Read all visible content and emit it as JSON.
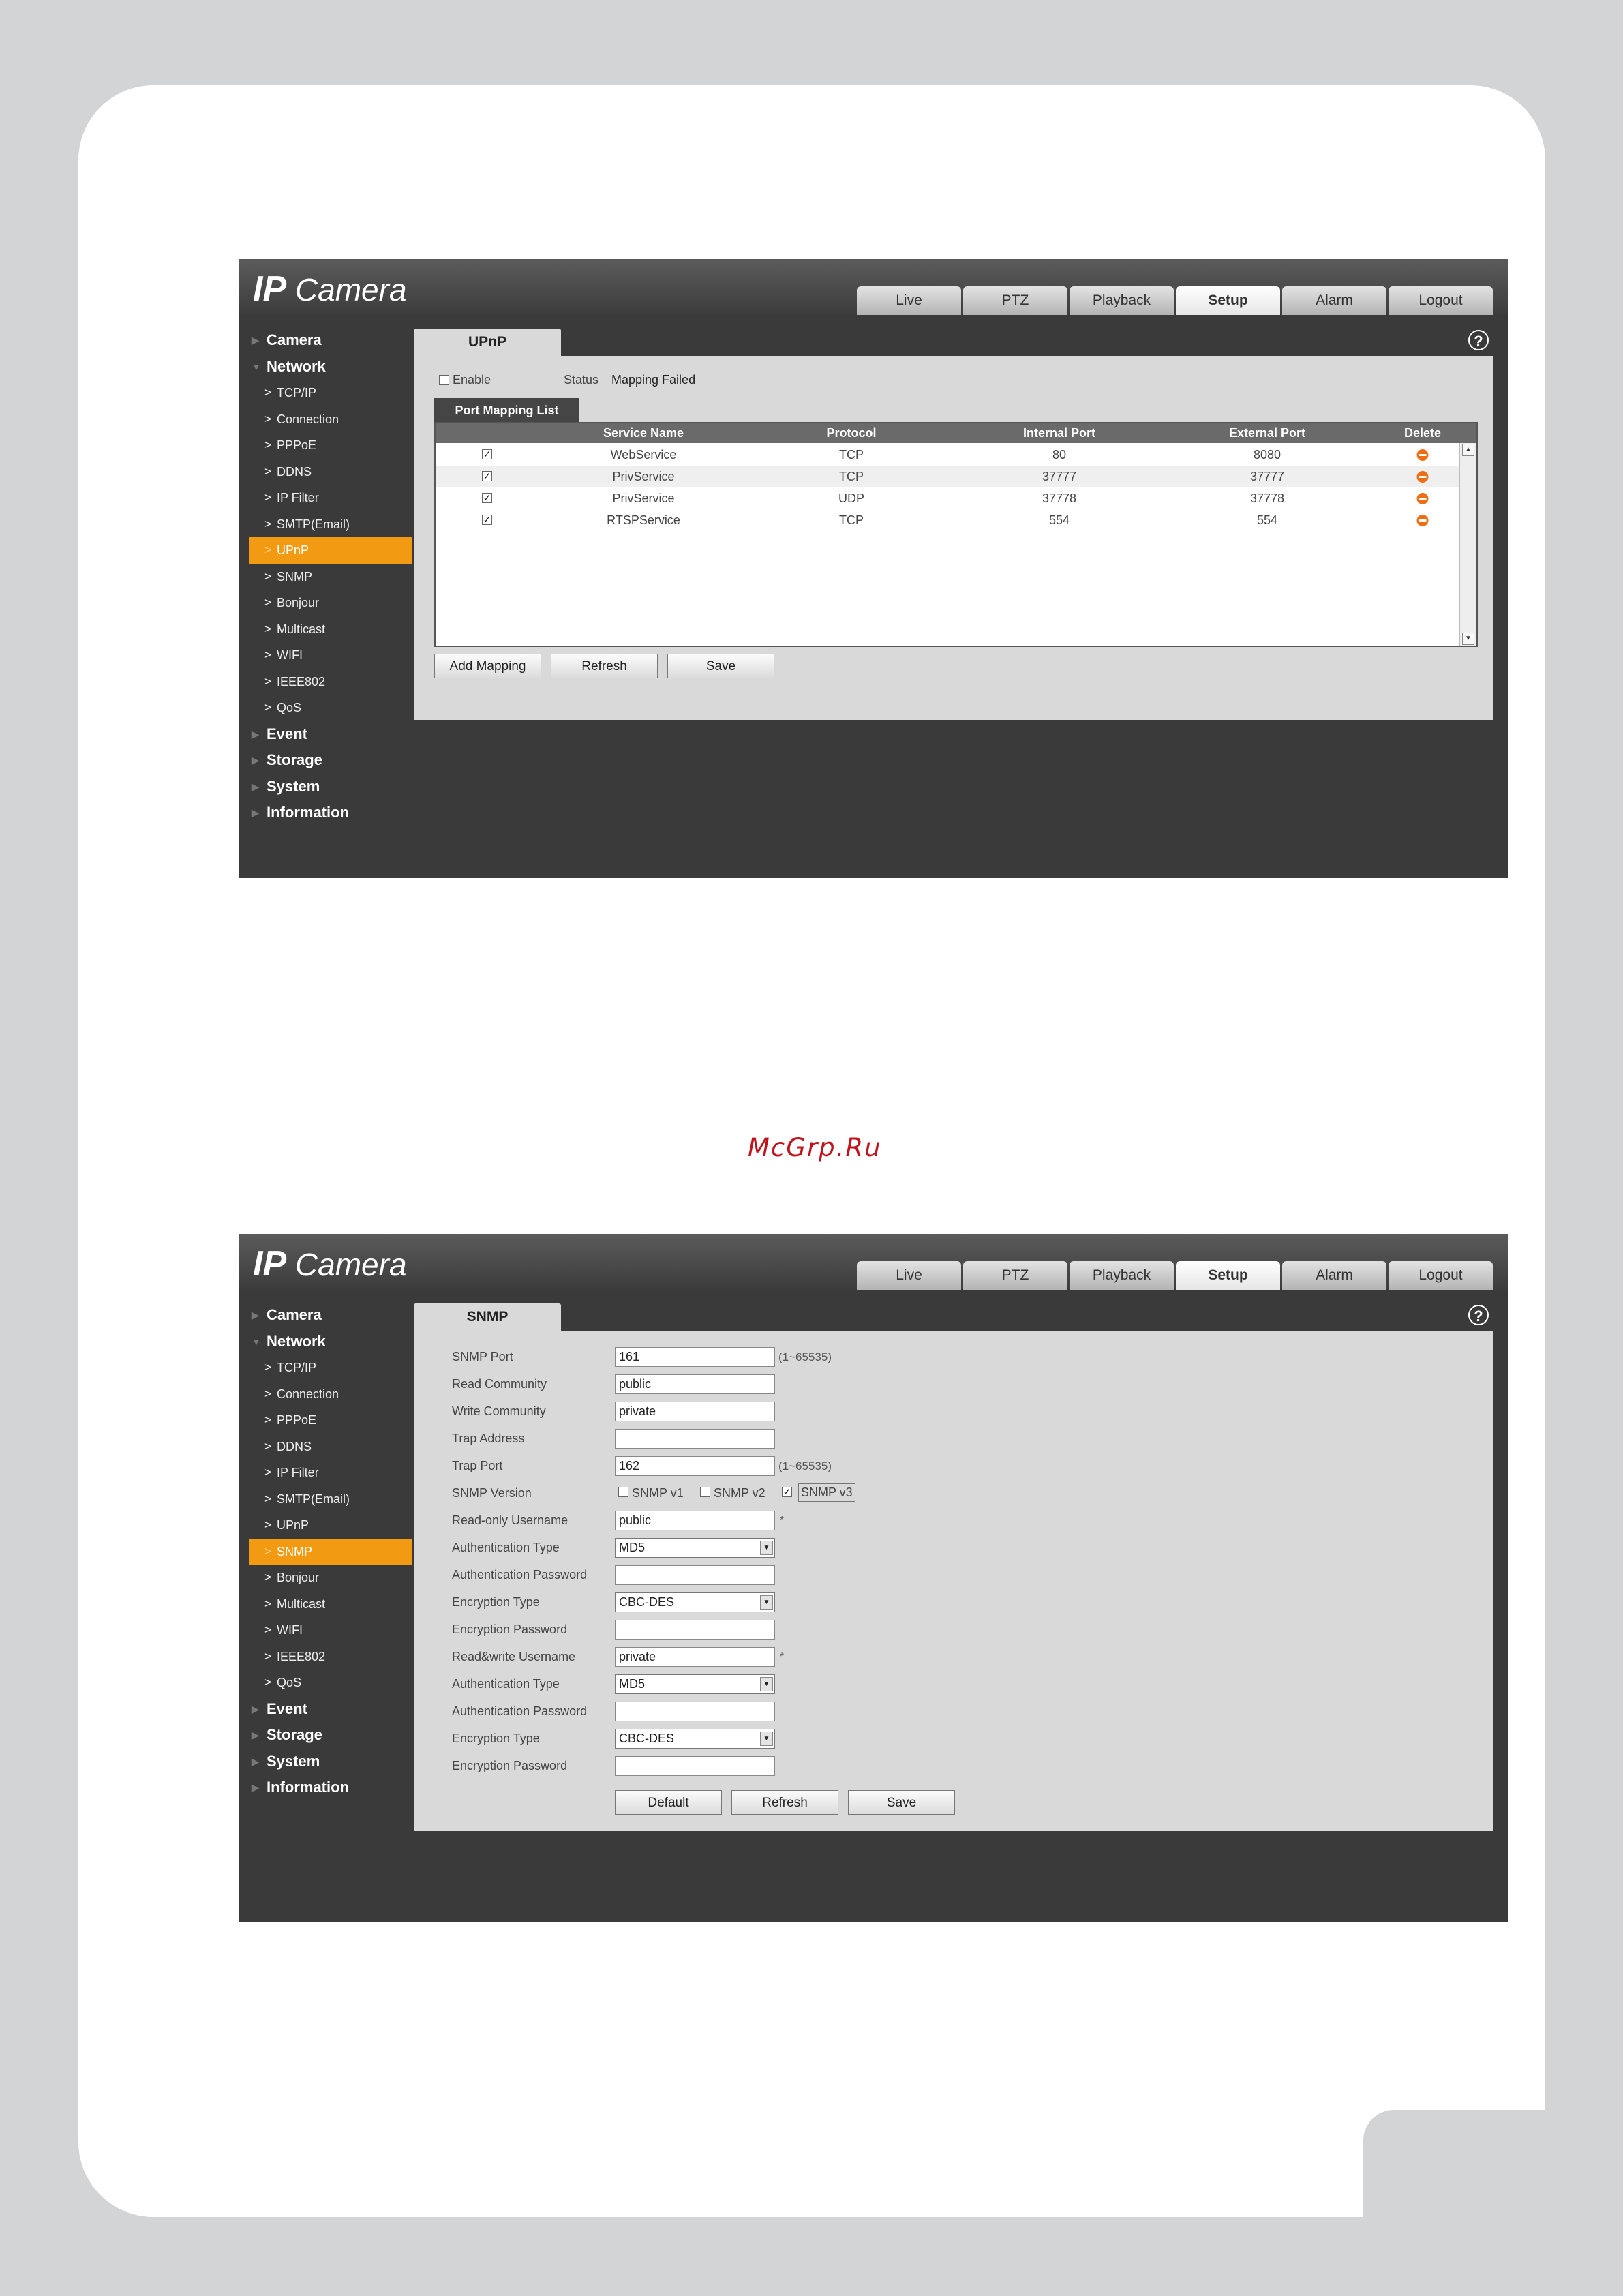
{
  "watermark": "McGrp.Ru",
  "app": {
    "logo_ip": "IP",
    "logo_camera": "Camera",
    "tabs": [
      "Live",
      "PTZ",
      "Playback",
      "Setup",
      "Alarm",
      "Logout"
    ],
    "active_tab": "Setup",
    "help_symbol": "?"
  },
  "sidebar": {
    "groups_before": [
      "Camera",
      "Network"
    ],
    "network_items": [
      "TCP/IP",
      "Connection",
      "PPPoE",
      "DDNS",
      "IP Filter",
      "SMTP(Email)",
      "UPnP",
      "SNMP",
      "Bonjour",
      "Multicast",
      "WIFI",
      "IEEE802",
      "QoS"
    ],
    "groups_after": [
      "Event",
      "Storage",
      "System",
      "Information"
    ]
  },
  "upnp": {
    "tab_title": "UPnP",
    "enable_label": "Enable",
    "status_label": "Status",
    "status_value": "Mapping Failed",
    "list_title": "Port Mapping List",
    "columns": [
      "Service Name",
      "Protocol",
      "Internal Port",
      "External Port",
      "Delete"
    ],
    "rows": [
      {
        "service": "WebService",
        "protocol": "TCP",
        "internal": "80",
        "external": "8080"
      },
      {
        "service": "PrivService",
        "protocol": "TCP",
        "internal": "37777",
        "external": "37777"
      },
      {
        "service": "PrivService",
        "protocol": "UDP",
        "internal": "37778",
        "external": "37778"
      },
      {
        "service": "RTSPService",
        "protocol": "TCP",
        "internal": "554",
        "external": "554"
      }
    ],
    "buttons": {
      "add": "Add Mapping",
      "refresh": "Refresh",
      "save": "Save"
    }
  },
  "snmp": {
    "tab_title": "SNMP",
    "fields": {
      "port_label": "SNMP Port",
      "port_value": "161",
      "port_hint": "(1~65535)",
      "read_community_label": "Read Community",
      "read_community_value": "public",
      "write_community_label": "Write Community",
      "write_community_value": "private",
      "trap_address_label": "Trap Address",
      "trap_address_value": "",
      "trap_port_label": "Trap Port",
      "trap_port_value": "162",
      "trap_port_hint": "(1~65535)",
      "version_label": "SNMP Version",
      "v1": "SNMP v1",
      "v2": "SNMP v2",
      "v3": "SNMP v3",
      "ro_user_label": "Read-only Username",
      "ro_user_value": "public",
      "ro_auth_type_label": "Authentication Type",
      "ro_auth_type_value": "MD5",
      "ro_auth_pwd_label": "Authentication Password",
      "ro_enc_type_label": "Encryption Type",
      "ro_enc_type_value": "CBC-DES",
      "ro_enc_pwd_label": "Encryption Password",
      "rw_user_label": "Read&write Username",
      "rw_user_value": "private",
      "rw_auth_type_label": "Authentication Type",
      "rw_auth_type_value": "MD5",
      "rw_auth_pwd_label": "Authentication Password",
      "rw_enc_type_label": "Encryption Type",
      "rw_enc_type_value": "CBC-DES",
      "rw_enc_pwd_label": "Encryption Password",
      "required_mark": "*"
    },
    "buttons": {
      "default": "Default",
      "refresh": "Refresh",
      "save": "Save"
    }
  }
}
